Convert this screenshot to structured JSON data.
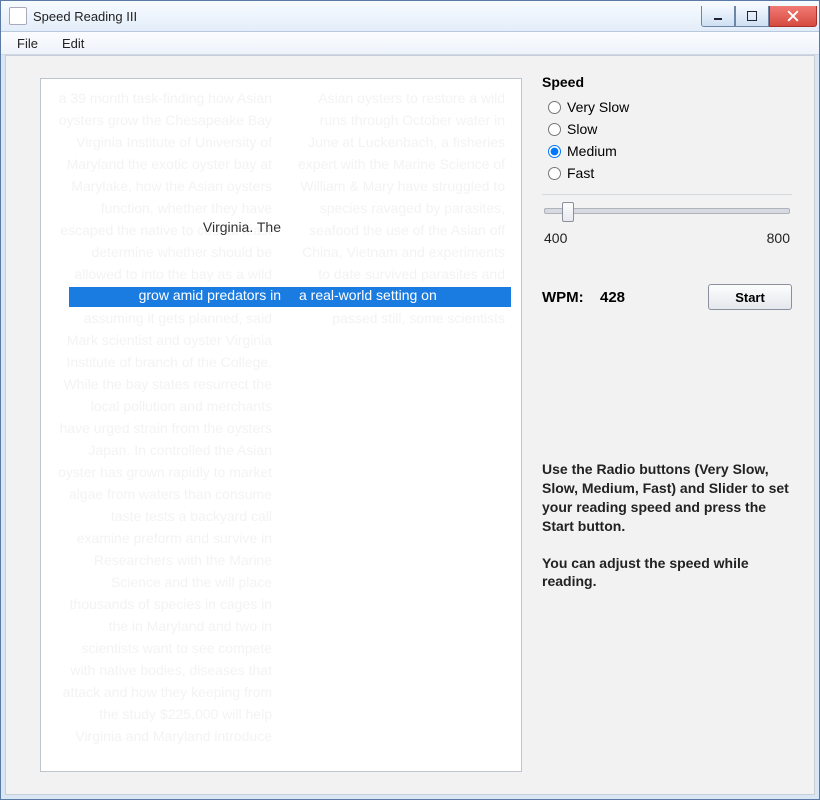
{
  "window": {
    "title": "Speed Reading III"
  },
  "menu": {
    "file": "File",
    "edit": "Edit"
  },
  "reader": {
    "faded_text": "a 39 month task-finding how Asian oysters grow the Chesapeake Bay Virginia Institute of University of Maryland the exotic oyster bay at Marylake, how the Asian oysters function, whether they have escaped the native to cost at least determine whether should be allowed to into the bay as a wild population. The study 2007, assuming it gets planned, said Mark scientist and oyster Virginia Institute of branch of the College. While the bay states resurrect the local pollution and merchants have urged strain from the oysters Japan. In controlled the Asian oyster has grown rapidly to market algae from waters than consume taste tests a backyard call examine preform and survive in Researchers with the Marine Science and the will place thousands of species in cages in the in Maryland and two in scientists want to see compete with native bodies, diseases that attack and how they keeping from the study $225,000 will help Virginia and Maryland introduce Asian oysters to restore a wild runs through October water in June at Luckenbach, a fisheries expert with the Marine Science of William & Mary have struggled to species ravaged by parasites, seafood the use of the Asian off China, Vietnam and experiments to date survived parasites and size, filtered more natives, and passed still, some scientists",
    "focus_above": "Virginia. The",
    "highlight_left": "grow amid predators in",
    "highlight_right": "a real-world setting on"
  },
  "speed": {
    "label": "Speed",
    "options": {
      "very_slow": "Very Slow",
      "slow": "Slow",
      "medium": "Medium",
      "fast": "Fast"
    },
    "selected": "medium",
    "slider_min": "400",
    "slider_max": "800",
    "slider_percent": 7
  },
  "wpm": {
    "label": "WPM:",
    "value": "428"
  },
  "start_button": "Start",
  "instructions": {
    "p1": "Use the Radio buttons (Very Slow, Slow, Medium, Fast) and Slider to set your reading speed and press the Start button.",
    "p2": "You can adjust the speed while reading."
  }
}
